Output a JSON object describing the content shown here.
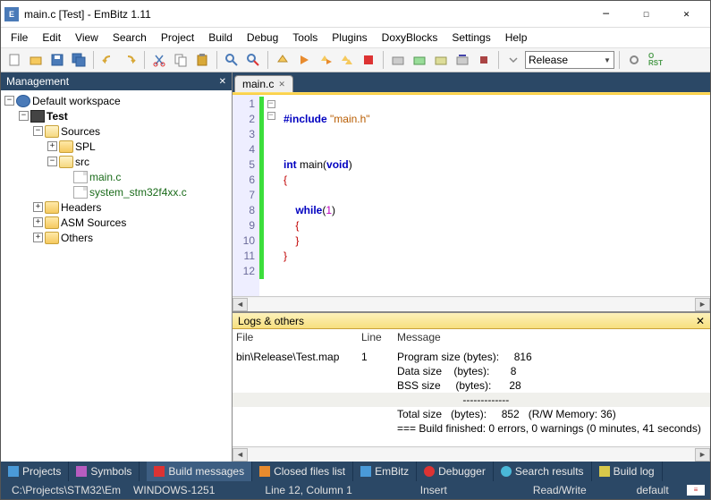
{
  "window": {
    "icon_letter": "E",
    "title": "main.c [Test] - EmBitz 1.11"
  },
  "menu": [
    "File",
    "Edit",
    "View",
    "Search",
    "Project",
    "Build",
    "Debug",
    "Tools",
    "Plugins",
    "DoxyBlocks",
    "Settings",
    "Help"
  ],
  "build_target": "Release",
  "management": {
    "title": "Management"
  },
  "tree": {
    "workspace": "Default workspace",
    "project": "Test",
    "sources": "Sources",
    "spl": "SPL",
    "src": "src",
    "file1": "main.c",
    "file2": "system_stm32f4xx.c",
    "headers": "Headers",
    "asm": "ASM Sources",
    "others": "Others"
  },
  "editor": {
    "tab": "main.c"
  },
  "code": {
    "l1": "",
    "l2": "#include \"main.h\"",
    "l4": "int",
    "l4b": " main(",
    "l4c": "void",
    "l4d": ")",
    "l5": "{",
    "l7": "while",
    "l7b": "(",
    "l7c": "1",
    "l7d": ")",
    "l8": "{",
    "l9": "}",
    "l10": "}"
  },
  "logs": {
    "title": "Logs & others",
    "h_file": "File",
    "h_line": "Line",
    "h_msg": "Message",
    "file": "bin\\Release\\Test.map",
    "line": "1",
    "r1": "Program size (bytes):     816",
    "r2": "Data size    (bytes):       8",
    "r3": "BSS size     (bytes):      28",
    "r4": "                      -------------",
    "r5": "Total size   (bytes):     852   (R/W Memory: 36)",
    "r6": "",
    "r7": "=== Build finished: 0 errors, 0 warnings (0 minutes, 41 seconds)"
  },
  "bottomtabs": {
    "projects": "Projects",
    "symbols": "Symbols",
    "buildmsg": "Build messages",
    "closed": "Closed files list",
    "embitz": "EmBitz",
    "debugger": "Debugger",
    "search": "Search results",
    "buildlog": "Build log"
  },
  "status": {
    "path": "C:\\Projects\\STM32\\Em",
    "enc": "WINDOWS-1251",
    "pos": "Line 12, Column 1",
    "ins": "Insert",
    "rw": "Read/Write",
    "conf": "default"
  }
}
